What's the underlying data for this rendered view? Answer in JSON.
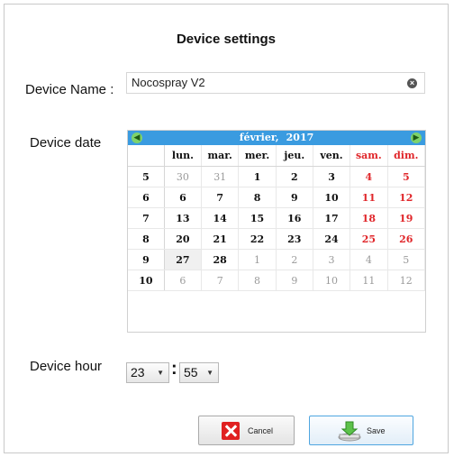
{
  "dialog": {
    "title": "Device settings"
  },
  "device_name": {
    "label": "Device Name :",
    "value": "Nocospray V2"
  },
  "device_date": {
    "label": "Device date",
    "calendar": {
      "month": "février,",
      "year": "2017",
      "weekday_headers": [
        "lun.",
        "mar.",
        "mer.",
        "jeu.",
        "ven.",
        "sam.",
        "dim."
      ],
      "weeks": [
        {
          "week": "5",
          "days": [
            "30",
            "31",
            "1",
            "2",
            "3",
            "4",
            "5"
          ]
        },
        {
          "week": "6",
          "days": [
            "6",
            "7",
            "8",
            "9",
            "10",
            "11",
            "12"
          ]
        },
        {
          "week": "7",
          "days": [
            "13",
            "14",
            "15",
            "16",
            "17",
            "18",
            "19"
          ]
        },
        {
          "week": "8",
          "days": [
            "20",
            "21",
            "22",
            "23",
            "24",
            "25",
            "26"
          ]
        },
        {
          "week": "9",
          "days": [
            "27",
            "28",
            "1",
            "2",
            "3",
            "4",
            "5"
          ]
        },
        {
          "week": "10",
          "days": [
            "6",
            "7",
            "8",
            "9",
            "10",
            "11",
            "12"
          ]
        }
      ]
    }
  },
  "device_hour": {
    "label": "Device hour",
    "hour": "23",
    "separator": ":",
    "minute": "55"
  },
  "buttons": {
    "cancel": "Cancel",
    "save": "Save"
  },
  "colors": {
    "header": "#3a9be0",
    "weekend": "#e0262a",
    "nav": "#7ed36b"
  }
}
